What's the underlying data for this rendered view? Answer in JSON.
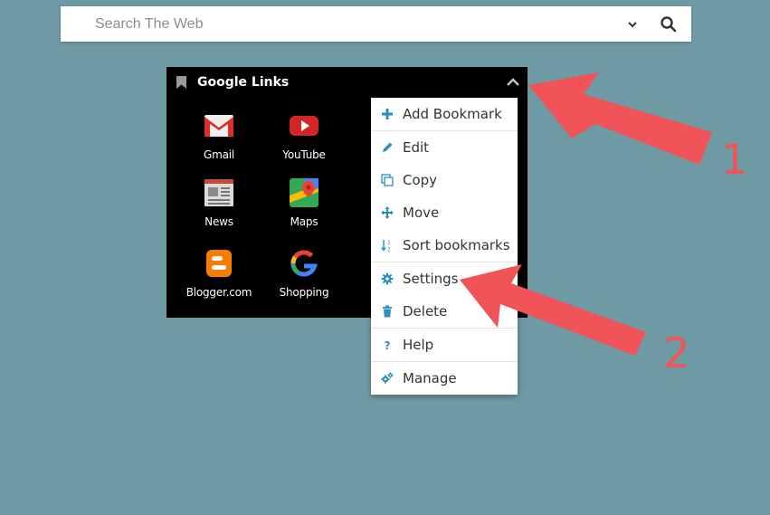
{
  "search": {
    "placeholder": "Search The Web",
    "value": ""
  },
  "widget": {
    "title": "Google Links",
    "tiles": [
      {
        "label": "Gmail",
        "icon": "gmail-icon"
      },
      {
        "label": "YouTube",
        "icon": "youtube-icon"
      },
      {
        "label": "News",
        "icon": "news-icon"
      },
      {
        "label": "Maps",
        "icon": "maps-icon"
      },
      {
        "label": "Blogger.com",
        "icon": "blogger-icon"
      },
      {
        "label": "Shopping",
        "icon": "google-icon"
      }
    ]
  },
  "menu": {
    "items": [
      {
        "label": "Add Bookmark",
        "icon": "plus-icon"
      },
      {
        "label": "Edit",
        "icon": "pencil-icon"
      },
      {
        "label": "Copy",
        "icon": "copy-icon"
      },
      {
        "label": "Move",
        "icon": "move-icon"
      },
      {
        "label": "Sort bookmarks",
        "icon": "sort-icon"
      },
      {
        "label": "Settings",
        "icon": "gear-icon"
      },
      {
        "label": "Delete",
        "icon": "trash-icon"
      },
      {
        "label": "Help",
        "icon": "question-icon"
      },
      {
        "label": "Manage",
        "icon": "gears-icon"
      }
    ]
  },
  "annotations": {
    "arrow1_number": "1",
    "arrow2_number": "2"
  },
  "colors": {
    "background": "#6e9aa4",
    "accent": "#2a8fbd",
    "annotation": "#f05358"
  }
}
